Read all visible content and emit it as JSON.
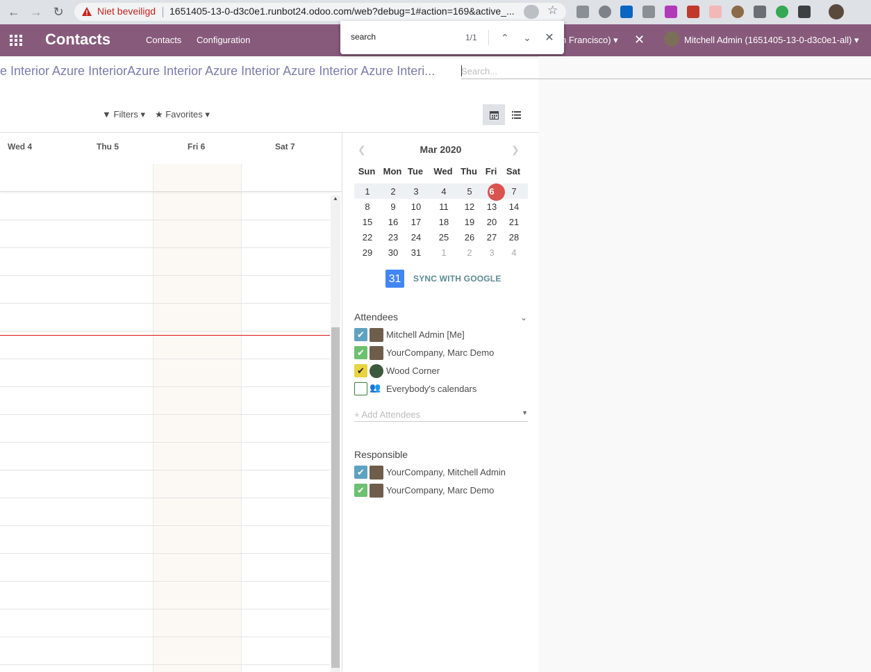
{
  "browser": {
    "security_label": "Niet beveiligd",
    "url": "1651405-13-0-d3c0e1.runbot24.odoo.com/web?debug=1#action=169&active_..."
  },
  "find_bar": {
    "query": "search",
    "count": "1/1"
  },
  "navbar": {
    "brand": "Contacts",
    "menus": [
      "Contacts",
      "Configuration"
    ],
    "timezone": "n Francisco)",
    "user": "Mitchell Admin (1651405-13-0-d3c0e1-all)"
  },
  "breadcrumb": "e Interior Azure InteriorAzure Interior Azure Interior Azure Interior Azure Interi...",
  "search": {
    "placeholder": "Search..."
  },
  "filters": {
    "filters_label": "Filters",
    "favorites_label": "Favorites"
  },
  "calendar": {
    "day_headers": [
      "Wed 4",
      "Thu 5",
      "Fri 6",
      "Sat 7"
    ]
  },
  "mini_calendar": {
    "title": "Mar 2020",
    "weekdays": [
      "Sun",
      "Mon",
      "Tue",
      "Wed",
      "Thu",
      "Fri",
      "Sat"
    ],
    "weeks": [
      [
        "1",
        "2",
        "3",
        "4",
        "5",
        "6",
        "7"
      ],
      [
        "8",
        "9",
        "10",
        "11",
        "12",
        "13",
        "14"
      ],
      [
        "15",
        "16",
        "17",
        "18",
        "19",
        "20",
        "21"
      ],
      [
        "22",
        "23",
        "24",
        "25",
        "26",
        "27",
        "28"
      ],
      [
        "29",
        "30",
        "31",
        "1",
        "2",
        "3",
        "4"
      ]
    ],
    "today": "6"
  },
  "sync": {
    "icon_text": "31",
    "label": "SYNC WITH GOOGLE"
  },
  "attendees": {
    "title": "Attendees",
    "items": [
      {
        "label": "Mitchell Admin [Me]",
        "color": "#5fa2c0"
      },
      {
        "label": "YourCompany, Marc Demo",
        "color": "#6cc070"
      },
      {
        "label": "Wood Corner",
        "color": "#e8d440"
      },
      {
        "label": "Everybody's calendars",
        "color": "#ffffff"
      }
    ],
    "add_placeholder": "+ Add Attendees"
  },
  "responsible": {
    "title": "Responsible",
    "items": [
      {
        "label": "YourCompany, Mitchell Admin",
        "color": "#5fa2c0"
      },
      {
        "label": "YourCompany, Marc Demo",
        "color": "#6cc070"
      }
    ]
  }
}
